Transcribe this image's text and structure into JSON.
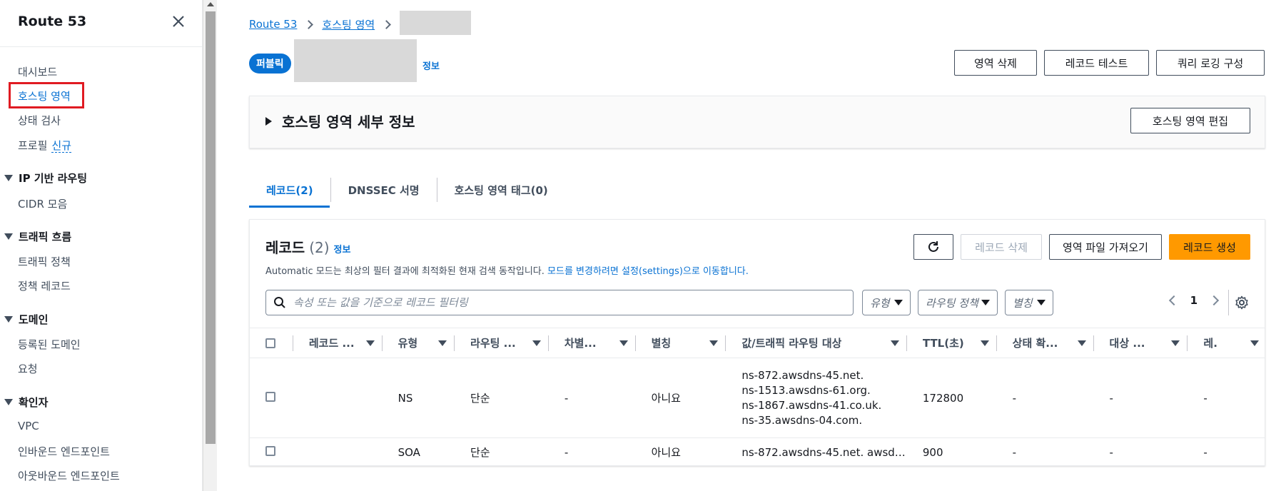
{
  "sidebar": {
    "title": "Route 53",
    "items": {
      "dashboard": "대시보드",
      "hosted_zones": "호스팅 영역",
      "health_checks": "상태 검사",
      "profiles": "프로필",
      "profiles_badge": "신규",
      "ip_routing_group": "IP 기반 라우팅",
      "cidr": "CIDR 모음",
      "traffic_flow_group": "트래픽 흐름",
      "traffic_policy": "트래픽 정책",
      "policy_records": "정책 레코드",
      "domains_group": "도메인",
      "registered_domains": "등록된 도메인",
      "requests": "요청",
      "resolver_group": "확인자",
      "vpc": "VPC",
      "inbound_endpoints": "인바운드 엔드포인트",
      "outbound_endpoints": "아웃바운드 엔드포인트"
    }
  },
  "breadcrumb": {
    "root": "Route 53",
    "hosted_zones": "호스팅 영역"
  },
  "zone": {
    "badge": "퍼블릭",
    "info": "정보"
  },
  "top_buttons": {
    "delete_zone": "영역 삭제",
    "test_record": "레코드 테스트",
    "query_logging": "쿼리 로깅 구성"
  },
  "details": {
    "title": "호스팅 영역 세부 정보",
    "edit_button": "호스팅 영역 편집"
  },
  "tabs": {
    "records": "레코드(2)",
    "dnssec": "DNSSEC 서명",
    "tags": "호스팅 영역 태그(0)"
  },
  "records_panel": {
    "title": "레코드",
    "count": "(2)",
    "info": "정보",
    "description": "Automatic 모드는 최상의 필터 결과에 최적화된 현재 검색 동작입니다.",
    "description_link": "모드를 변경하려면 설정(settings)으로 이동합니다.",
    "delete_button": "레코드 삭제",
    "import_button": "영역 파일 가져오기",
    "create_button": "레코드 생성",
    "filter_placeholder": "속성 또는 값을 기준으로 레코드 필터링",
    "type_select": "유형",
    "routing_select": "라우팅 정책",
    "alias_select": "별칭",
    "page": "1"
  },
  "table": {
    "headers": {
      "name": "레코드 ...",
      "type": "유형",
      "routing": "라우팅 ...",
      "diff": "차별...",
      "alias": "별칭",
      "value": "값/트래픽 라우팅 대상",
      "ttl": "TTL(초)",
      "health": "상태 확...",
      "target": "대상 ...",
      "last": "레."
    },
    "rows": [
      {
        "name": "",
        "type": "NS",
        "routing": "단순",
        "diff": "-",
        "alias": "아니요",
        "value_lines": [
          "ns-872.awsdns-45.net.",
          "ns-1513.awsdns-61.org.",
          "ns-1867.awsdns-41.co.uk.",
          "ns-35.awsdns-04.com."
        ],
        "ttl": "172800",
        "health": "-",
        "target": "-",
        "last": "-"
      },
      {
        "name": "",
        "type": "SOA",
        "routing": "단순",
        "diff": "-",
        "alias": "아니요",
        "value": "ns-872.awsdns-45.net. awsd…",
        "ttl": "900",
        "health": "-",
        "target": "-",
        "last": "-"
      }
    ]
  },
  "colors": {
    "accent": "#0972d3",
    "primary_button": "#ff9900",
    "highlight": "#e01b22"
  }
}
